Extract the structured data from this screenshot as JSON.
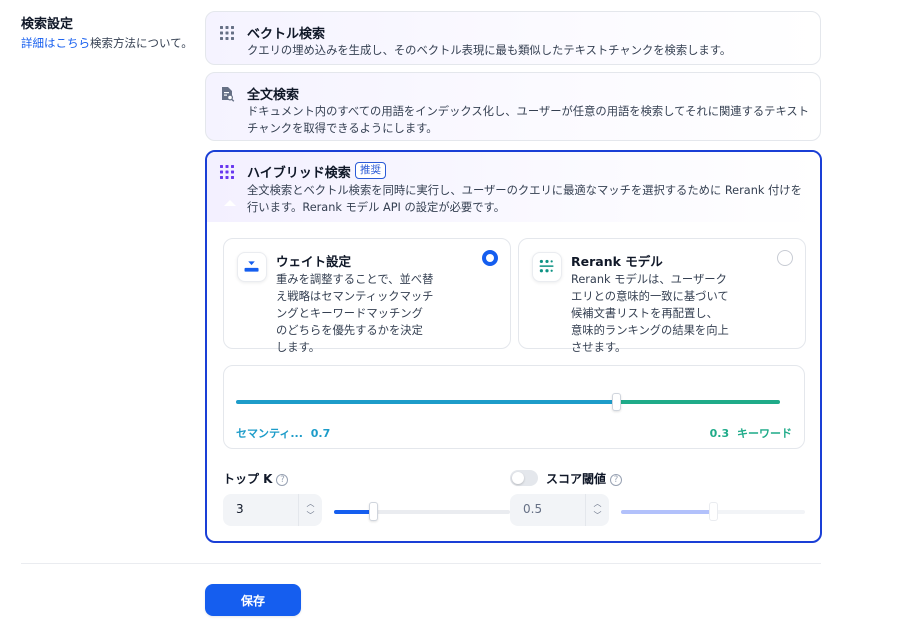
{
  "section": {
    "title": "検索設定",
    "desc_link": "詳細はこちら",
    "desc_rest": "検索方法について。"
  },
  "vector_search": {
    "icon": "grid-dots-icon",
    "title": "ベクトル検索",
    "desc": "クエリの埋め込みを生成し、そのベクトル表現に最も類似したテキストチャンクを検索します。"
  },
  "fulltext_search": {
    "icon": "document-search-icon",
    "title": "全文検索",
    "desc": "ドキュメント内のすべての用語をインデックス化し、ユーザーが任意の用語を検索してそれに関連するテキストチャンクを取得できるようにします。"
  },
  "hybrid_search": {
    "icon": "grid-dots-icon",
    "title": "ハイブリッド検索",
    "badge": "推奨",
    "desc": "全文検索とベクトル検索を同時に実行し、ユーザーのクエリに最適なマッチを選択するために Rerank 付けを行います。Rerank モデル API の設定が必要です。",
    "options": [
      {
        "title": "ウェイト設定",
        "desc": "重みを調整することで、並べ替え戦略はセマンティックマッチングとキーワードマッチングのどちらを優先するかを決定します。",
        "selected": true
      },
      {
        "title": "Rerank モデル",
        "desc": "Rerank モデルは、ユーザークエリとの意味的一致に基づいて候補文書リストを再配置し、意味的ランキングの結果を向上させます。",
        "selected": false
      }
    ],
    "weights": {
      "semantic_label": "セマンティ...",
      "semantic_value": "0.7",
      "keyword_value": "0.3",
      "keyword_label": "キーワード",
      "semantic_fraction": 0.7,
      "semantic_color": "#1d9cc9",
      "keyword_color": "#1fab89"
    },
    "top_k": {
      "label": "トップ K",
      "help": "?",
      "value": "3",
      "slider_fraction": 0.22
    },
    "score_threshold": {
      "label": "スコア閾値",
      "help": "?",
      "enabled": false,
      "value": "0.5",
      "slider_fraction": 0.5
    }
  },
  "save_label": "保存",
  "colors": {
    "primary": "#155eef",
    "hybrid_border": "#1a3fd6",
    "icon_purple": "#6938ef"
  }
}
